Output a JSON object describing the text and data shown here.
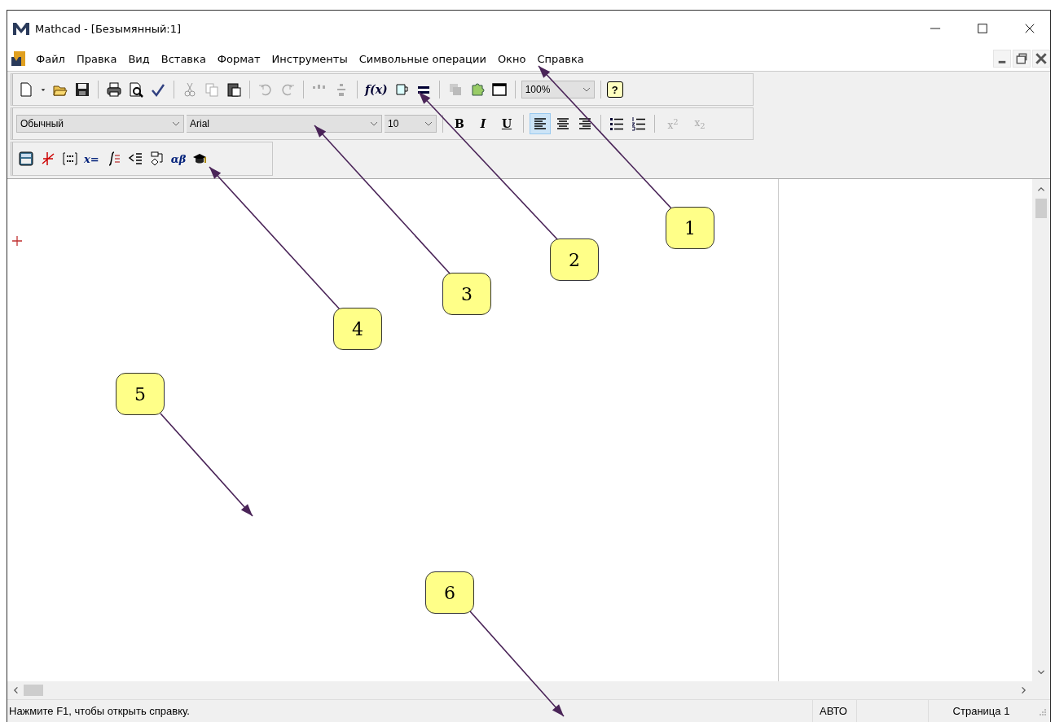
{
  "window": {
    "title": "Mathcad - [Безымянный:1]"
  },
  "menu": [
    "Файл",
    "Правка",
    "Вид",
    "Вставка",
    "Формат",
    "Инструменты",
    "Символьные операции",
    "Окно",
    "Справка"
  ],
  "standard_toolbar": {
    "function_label": "f(x)",
    "zoom": "100%",
    "help": "?"
  },
  "format_toolbar": {
    "style": "Обычный",
    "font": "Arial",
    "size": "10",
    "text_styles": [
      "B",
      "I",
      "U"
    ],
    "alignments": [
      {
        "selected": true
      },
      {
        "selected": false
      },
      {
        "selected": false
      }
    ],
    "scripts": [
      {
        "label": "x$^{2}$",
        "disabled": true
      },
      {
        "label": "x$_{2}$",
        "disabled": true
      }
    ]
  },
  "math_toolbar": [
    {
      "kind": "calculator"
    },
    {
      "kind": "graph"
    },
    {
      "kind": "matrix"
    },
    {
      "kind": "text",
      "label": "x="
    },
    {
      "kind": "calculus"
    },
    {
      "kind": "boolean"
    },
    {
      "kind": "programming"
    },
    {
      "kind": "text",
      "label": "αβ"
    },
    {
      "kind": "symbolic"
    }
  ],
  "status_bar": {
    "message": "Нажмите F1, чтобы открыть справку.",
    "mode": "АВТО",
    "page": "Страница 1"
  },
  "callouts": [
    "1",
    "2",
    "3",
    "4",
    "5",
    "6"
  ]
}
